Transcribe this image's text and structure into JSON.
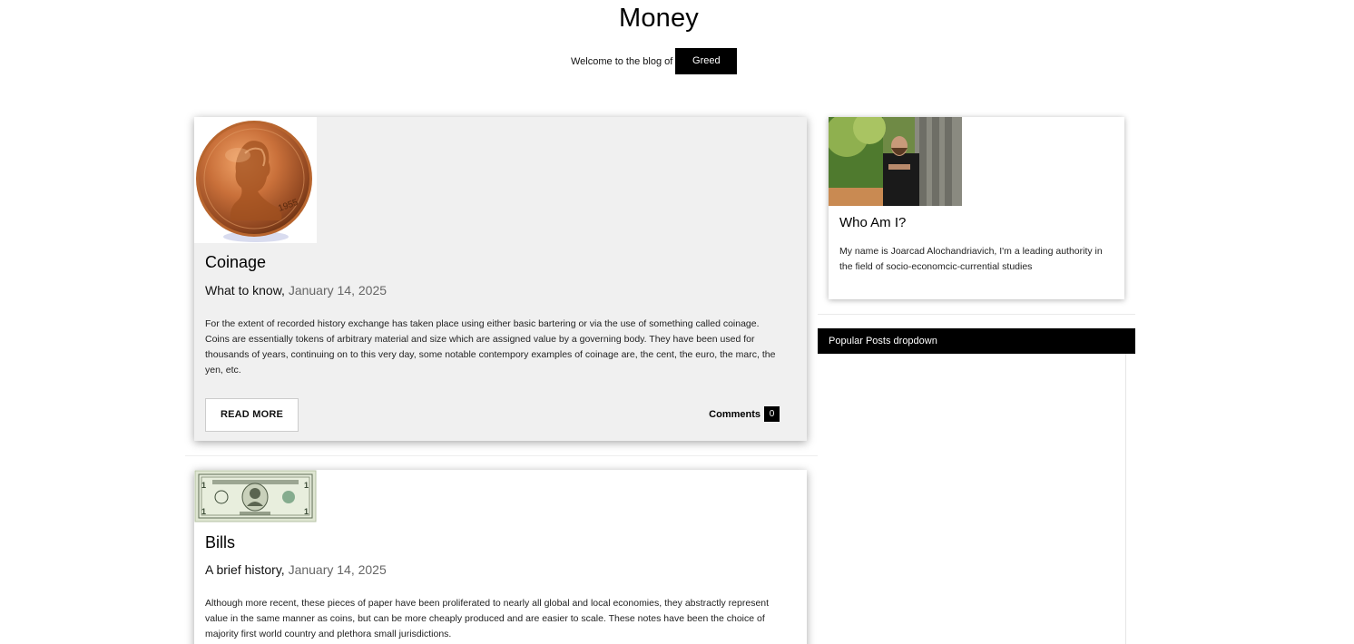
{
  "header": {
    "site_title": "Money",
    "welcome_text": "Welcome to the blog of",
    "author_button": "Greed"
  },
  "posts": [
    {
      "image_icon": "penny-coin-image",
      "title": "Coinage",
      "subtitle": "What to know,",
      "date": "January 14, 2025",
      "body": "For the extent of recorded history exchange has taken place using either basic bartering or via the use of something called coinage. Coins are essentially tokens of arbitrary material and size which are assigned value by a governing body. They have been used for thousands of years, continuing on to this very day, some notable contempory examples of coinage are, the cent, the euro, the marc, the yen, etc.",
      "read_more": "READ MORE",
      "comments_label": "Comments",
      "comments_count": "0",
      "background": "#f0f0f0"
    },
    {
      "image_icon": "dollar-bill-image",
      "title": "Bills",
      "subtitle": "A brief history,",
      "date": "January 14, 2025",
      "body": "Although more recent, these pieces of paper have been proliferated to nearly all global and local economies, they abstractly represent value in the same manner as coins, but can be more cheaply produced and are easier to scale. These notes have been the choice of majority first world country and plethora small jurisdictions.",
      "background": "#ffffff"
    }
  ],
  "sidebar": {
    "about": {
      "photo_icon": "author-photo",
      "title": "Who Am I?",
      "text": "My name is Joarcad Alochandriavich, I'm a leading authority in the field of socio-economcic-currential studies"
    },
    "popular_posts": "Popular Posts dropdown"
  },
  "colors": {
    "accent": "#000000",
    "card_highlight": "#f0f0f0",
    "date_text": "#666666"
  }
}
